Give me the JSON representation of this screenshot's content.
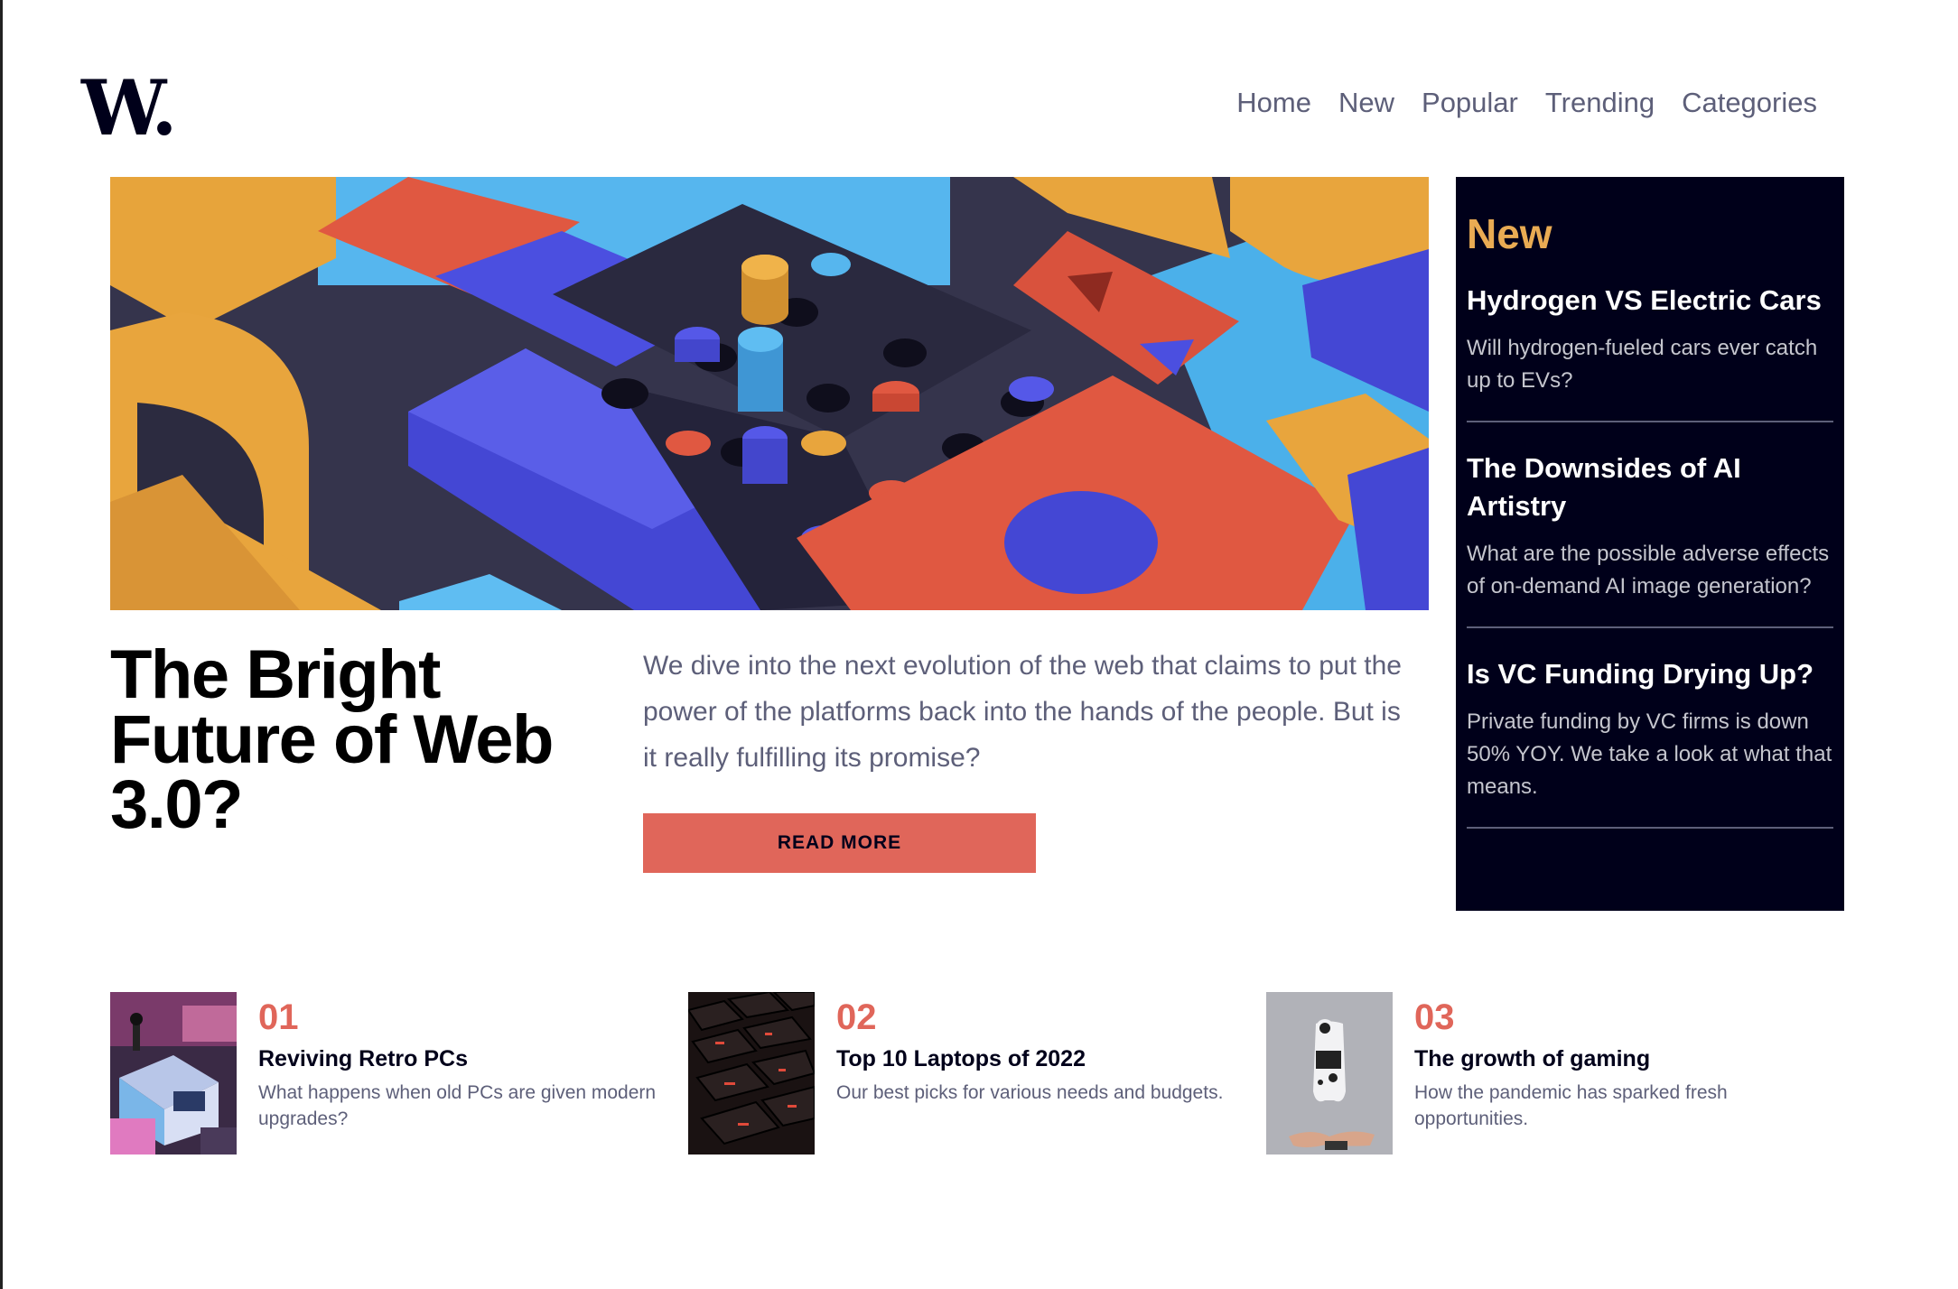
{
  "header": {
    "logo": "W.",
    "nav": [
      "Home",
      "New",
      "Popular",
      "Trending",
      "Categories"
    ]
  },
  "hero": {
    "image_icon": "abstract-blocks-image",
    "title": "The Bright Future of Web 3.0?",
    "description": "We dive into the next evolution of the web that claims to put the power of the platforms back into the hands of the people. But is it really fulfilling its promise?",
    "button_label": "READ MORE"
  },
  "sidebar": {
    "title": "New",
    "items": [
      {
        "title": "Hydrogen VS Electric Cars",
        "description": "Will hydrogen-fueled cars ever catch up to EVs?"
      },
      {
        "title": "The Downsides of AI Artistry",
        "description": "What are the possible adverse effects of on-demand AI image generation?"
      },
      {
        "title": "Is VC Funding Drying Up?",
        "description": "Private funding by VC firms is down 50% YOY. We take a look at what that means."
      }
    ]
  },
  "articles": [
    {
      "number": "01",
      "title": "Reviving Retro PCs",
      "description": "What happens when old PCs are given modern upgrades?",
      "thumb_icon": "retro-pc-image"
    },
    {
      "number": "02",
      "title": "Top 10 Laptops of 2022",
      "description": "Our best picks for various needs and budgets.",
      "thumb_icon": "laptop-keyboard-image"
    },
    {
      "number": "03",
      "title": "The growth of gaming",
      "description": "How the pandemic has sparked fresh opportunities.",
      "thumb_icon": "game-controller-image"
    }
  ],
  "colors": {
    "accent": "#e0665a",
    "sidebar_bg": "#00001a",
    "sidebar_title": "#e9ab53",
    "text_muted": "#5d5f79"
  }
}
